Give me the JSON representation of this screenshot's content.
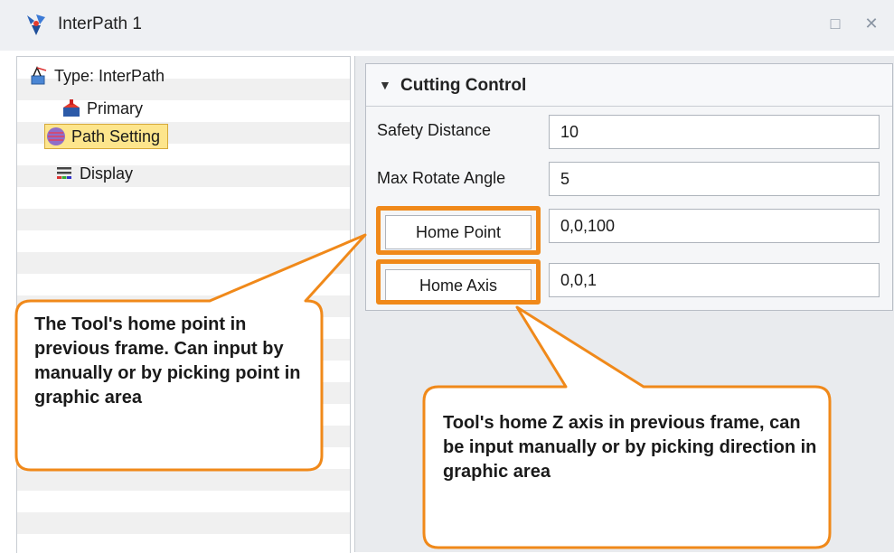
{
  "window": {
    "title": "InterPath 1",
    "icons": [
      "interpath-app-icon",
      "pin-icon",
      "close-icon"
    ]
  },
  "tree": {
    "root_label": "Type: InterPath",
    "items": [
      {
        "label": "Primary",
        "icon": "primary-icon"
      },
      {
        "label": "Path Setting",
        "icon": "path-setting-icon",
        "selected": true
      },
      {
        "label": "Display",
        "icon": "display-icon"
      }
    ]
  },
  "cutting_control": {
    "header": "Cutting Control",
    "collapse_icon": "triangle-down-icon",
    "safety_distance": {
      "label": "Safety Distance",
      "value": "10"
    },
    "max_rotate_angle": {
      "label": "Max Rotate Angle",
      "value": "5"
    },
    "home_point": {
      "label": "Home Point",
      "value": "0,0,100"
    },
    "home_axis": {
      "label": "Home Axis",
      "value": "0,0,1"
    }
  },
  "callouts": {
    "home_point": "The Tool's home point in previous frame. Can input by manually or by picking point in graphic area",
    "home_axis": "Tool's home Z axis in previous frame, can be input manually or by picking direction in graphic area"
  },
  "colors": {
    "highlight": "#f0891a",
    "selection": "#fde58c",
    "panel": "#e9ebee"
  }
}
